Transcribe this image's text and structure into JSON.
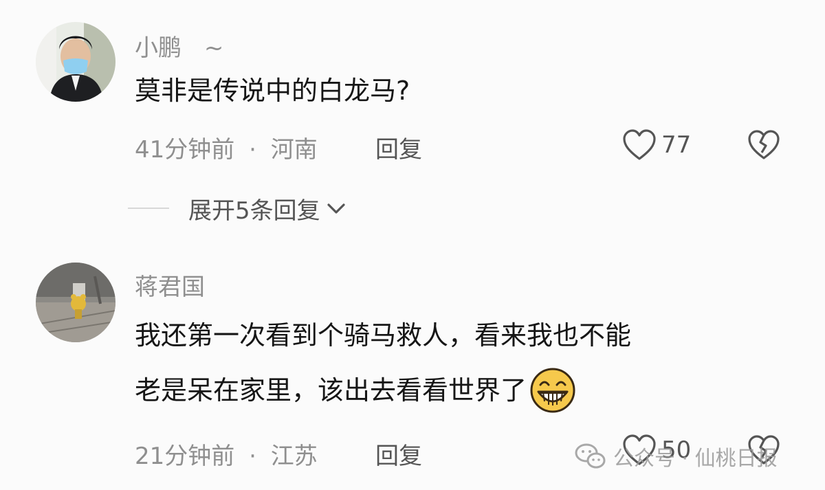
{
  "comments": [
    {
      "username": "小鹏",
      "username_suffix": "~",
      "text_lines": [
        "莫非是传说中的白龙马?"
      ],
      "time": "41分钟前",
      "separator": "·",
      "location": "河南",
      "reply_label": "回复",
      "likes": "77",
      "expand_label": "展开5条回复"
    },
    {
      "username": "蒋君国",
      "text_lines": [
        "我还第一次看到个骑马救人，看来我也不能",
        "老是呆在家里，该出去看看世界了"
      ],
      "time": "21分钟前",
      "separator": "·",
      "location": "江苏",
      "reply_label": "回复",
      "likes": "50"
    }
  ],
  "watermark": {
    "icon": "wechat-icon",
    "text": "公众号 · 仙桃日报"
  },
  "colors": {
    "meta": "#8f8f8f",
    "text": "#161616",
    "icon": "#555555"
  }
}
